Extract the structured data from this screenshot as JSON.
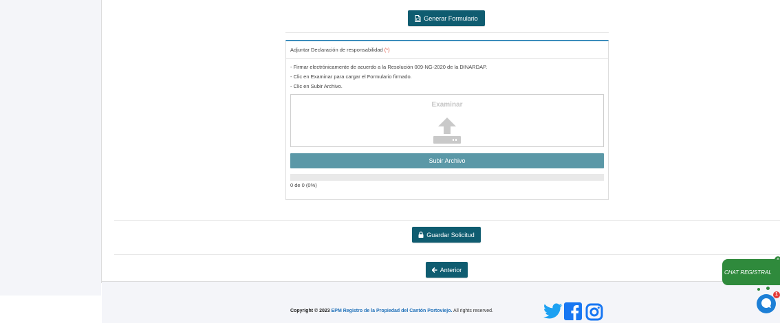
{
  "form": {
    "generate_label": "Generar Formulario",
    "save_label": "Guardar Solicitud",
    "previous_label": "Anterior"
  },
  "panel": {
    "title": "Adjuntar Declaración de responsabilidad",
    "required_mark": "(*)",
    "instructions": [
      "- Firmar electrónicamente de acuerdo a la Resolución 009-NG-2020 de la DINARDAP.",
      "- Clic en Examinar para cargar el Formulario firmado.",
      "- Clic en Subir Archivo."
    ],
    "browse_label": "Examinar",
    "upload_label": "Subir Archivo",
    "progress_text": "0 de 0 (0%)",
    "progress_percent": 0
  },
  "footer": {
    "copyright_prefix": "Copyright © 2023",
    "brand": "EPM Registro de la Propiedad del Cantón Portoviejo.",
    "rights": "All rights reserved.",
    "social_icons": [
      "twitter-icon",
      "facebook-icon",
      "instagram-icon"
    ]
  },
  "chat": {
    "label": "CHAT REGISTRAL",
    "close_glyph": "×",
    "badge_count": "1"
  },
  "colors": {
    "primary": "#0f5c70",
    "upload": "#5b98a7",
    "panel_accent": "#3c8dbc",
    "chat": "#2f8a3c",
    "twitter": "#1da1f2",
    "facebook": "#1877f2"
  }
}
